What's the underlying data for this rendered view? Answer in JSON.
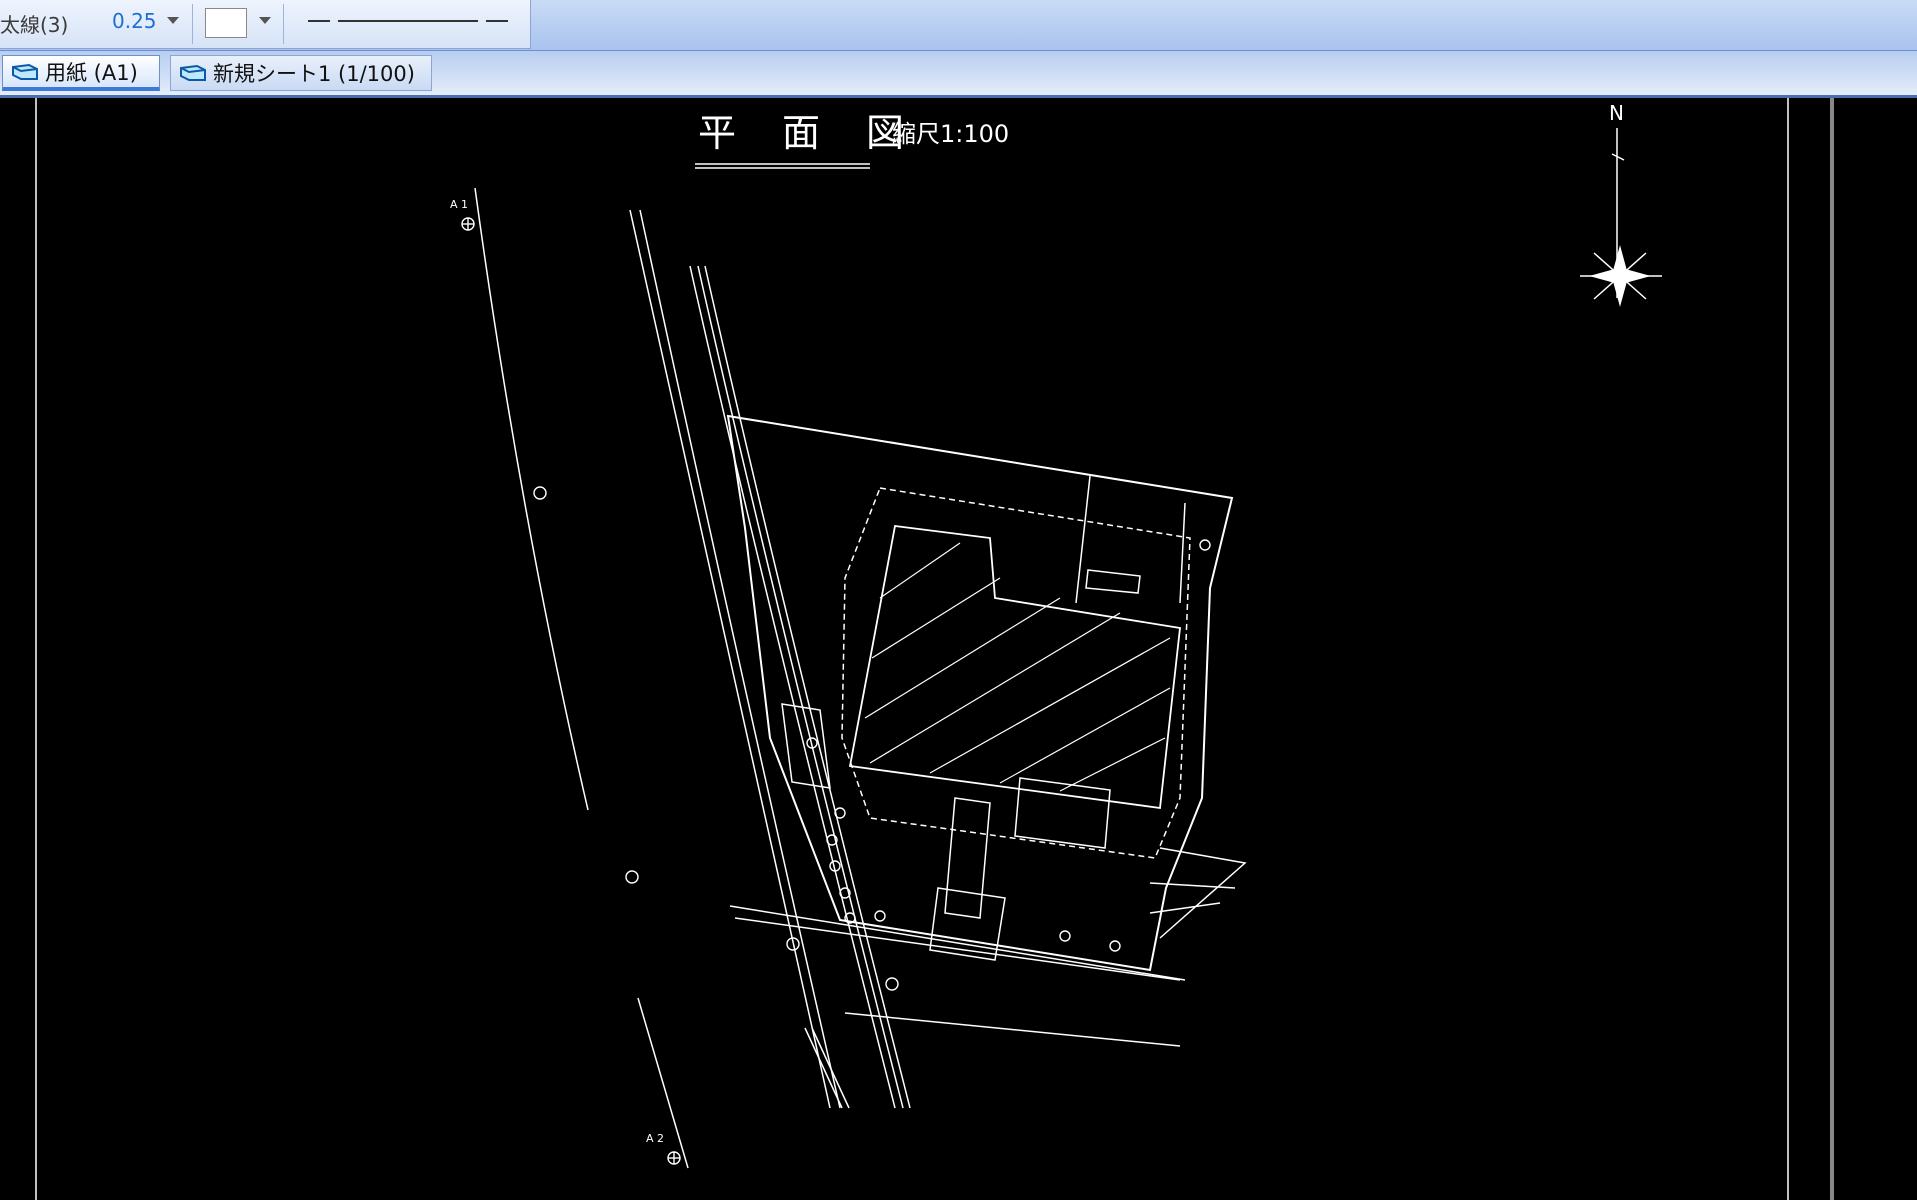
{
  "toolbar": {
    "line_weight_label": "太線(3)",
    "line_width_value": "0.25",
    "color_value": "#ffffff"
  },
  "tabs": [
    {
      "label": "用紙 (A1)",
      "active": true
    },
    {
      "label": "新規シート1 (1/100)",
      "active": false
    }
  ],
  "drawing": {
    "title": "平　面　図",
    "scale": "縮尺1:100",
    "north_label": "N",
    "survey_point_labels": [
      "A 1",
      "A 2"
    ]
  },
  "colors": {
    "canvas_bg": "#000000",
    "line": "#ffffff",
    "toolbar_bg": "#c9dbf5",
    "accent": "#1f6fd1"
  }
}
